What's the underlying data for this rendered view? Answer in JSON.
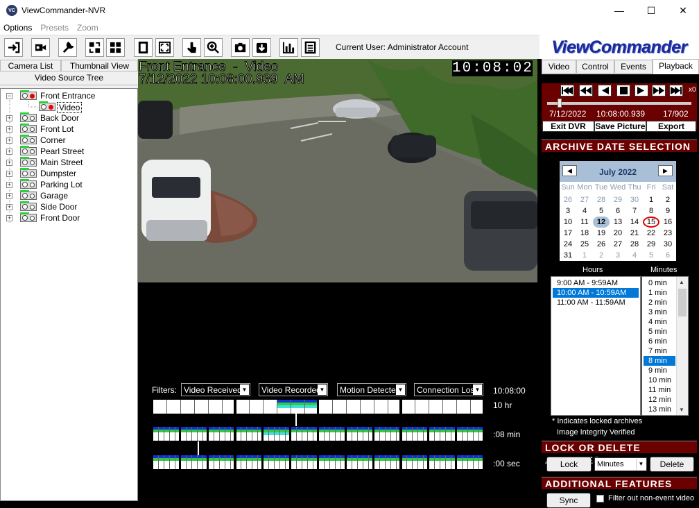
{
  "window": {
    "title": "ViewCommander-NVR",
    "minimize": "—",
    "maximize": "☐",
    "close": "✕"
  },
  "menu": {
    "items": [
      "Options",
      "Presets",
      "Zoom"
    ]
  },
  "toolbar": {
    "current_user": "Current User: Administrator Account"
  },
  "logo": {
    "text": "ViewCommander"
  },
  "left_tabs": {
    "camera_list": "Camera List",
    "thumbnail_view": "Thumbnail View",
    "video_source_tree": "Video Source Tree"
  },
  "tree": {
    "root": "Front Entrance",
    "child": "Video",
    "cameras": [
      "Back Door",
      "Front Lot",
      "Corner",
      "Pearl Street",
      "Main Street",
      "Dumpster",
      "Parking Lot",
      "Garage",
      "Side Door",
      "Front Door"
    ]
  },
  "video": {
    "overlay_title": "Front Entrance  -  Video",
    "overlay_timestamp": "7/12/2022 10:08:00.939  AM",
    "clock": "10:08:02"
  },
  "filters": {
    "label": "Filters:",
    "selects": [
      "Video Received",
      "Video Recorded",
      "Motion Detected",
      "Connection Loss"
    ],
    "time_readout": "10:08:00"
  },
  "timeline": {
    "hr_label": "10 hr",
    "min_label": ":08 min",
    "sec_label": ":00 sec"
  },
  "right_tabs": {
    "video": "Video",
    "control": "Control",
    "events": "Events",
    "playback": "Playback"
  },
  "playback": {
    "speed": "x0",
    "date": "7/12/2022",
    "time": "10:08:00.939",
    "frame": "17/902",
    "exit_dvr": "Exit DVR",
    "save_picture": "Save Picture",
    "export": "Export"
  },
  "archive": {
    "heading": "ARCHIVE DATE SELECTION",
    "month": "July 2022",
    "prev": "◀",
    "next": "▶",
    "dow": [
      "Sun",
      "Mon",
      "Tue",
      "Wed",
      "Thu",
      "Fri",
      "Sat"
    ],
    "weeks": [
      [
        "26",
        "27",
        "28",
        "29",
        "30",
        "1",
        "2"
      ],
      [
        "3",
        "4",
        "5",
        "6",
        "7",
        "8",
        "9"
      ],
      [
        "10",
        "11",
        "12",
        "13",
        "14",
        "15",
        "16"
      ],
      [
        "17",
        "18",
        "19",
        "20",
        "21",
        "22",
        "23"
      ],
      [
        "24",
        "25",
        "26",
        "27",
        "28",
        "29",
        "30"
      ],
      [
        "31",
        "1",
        "2",
        "3",
        "4",
        "5",
        "6"
      ]
    ],
    "selected_day": "12",
    "today": "15",
    "hours_label": "Hours",
    "minutes_label": "Minutes",
    "hours": [
      "9:00 AM - 9:59AM",
      "10:00 AM - 10:59AM",
      "11:00 AM - 11:59AM"
    ],
    "selected_hour": "10:00 AM - 10:59AM",
    "minutes": [
      "0 min",
      "1 min",
      "2 min",
      "3 min",
      "4 min",
      "5 min",
      "6 min",
      "7 min",
      "8 min",
      "9 min",
      "10 min",
      "11 min",
      "12 min",
      "13 min"
    ],
    "selected_minute": "8 min",
    "note_locked": "* Indicates locked archives",
    "note_integrity": "Image Integrity Verified"
  },
  "lock_delete": {
    "heading": "LOCK OR DELETE ARCHIVES",
    "lock": "Lock",
    "unit": "Minutes",
    "delete": "Delete"
  },
  "additional": {
    "heading": "ADDITIONAL FEATURES",
    "sync": "Sync",
    "filter_label": "Filter out non-event video"
  },
  "colors": {
    "accent_dark_red": "#6b0000",
    "selection_blue": "#0078d7",
    "logo_blue": "#1a2a9a",
    "recording_green": "#2ecc40",
    "motion_blue": "#1030d0",
    "event_cyan": "#40e0e0"
  }
}
